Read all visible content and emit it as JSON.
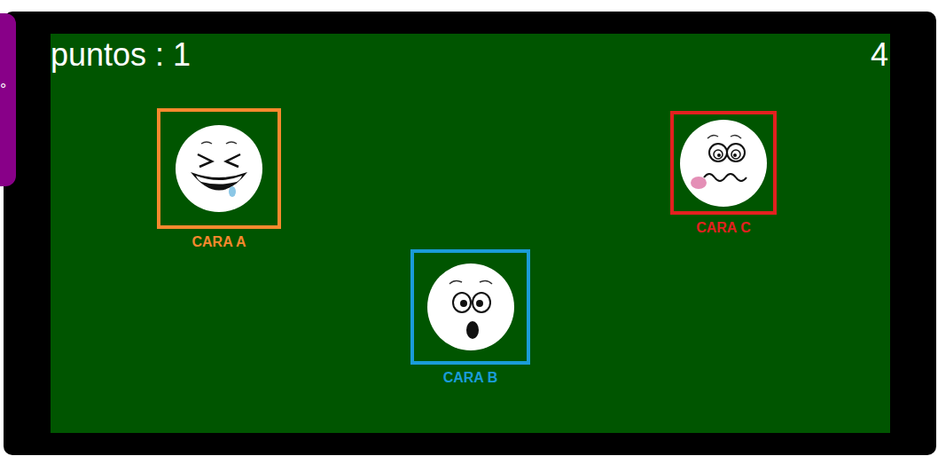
{
  "side_tab": {
    "text": "°"
  },
  "hud": {
    "score": "puntos : 1",
    "timer": "4"
  },
  "faces": [
    {
      "label": "CARA A",
      "kind": "laughing",
      "color": "#f7892e"
    },
    {
      "label": "CARA B",
      "kind": "surprised",
      "color": "#1a9cd8"
    },
    {
      "label": "CARA C",
      "kind": "dizzy",
      "color": "#e3201f"
    }
  ]
}
